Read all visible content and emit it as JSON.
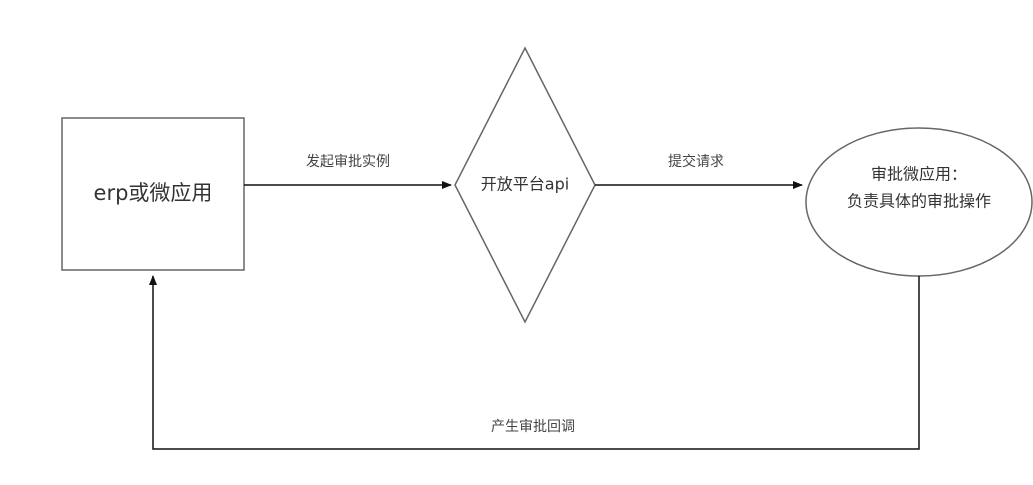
{
  "nodes": {
    "erp": {
      "label": "erp或微应用"
    },
    "platform": {
      "label": "开放平台api"
    },
    "approval": {
      "line1": "审批微应用：",
      "line2": "负责具体的审批操作"
    }
  },
  "edges": {
    "start_instance": {
      "label": "发起审批实例"
    },
    "submit_request": {
      "label": "提交请求"
    },
    "callback": {
      "label": "产生审批回调"
    }
  }
}
